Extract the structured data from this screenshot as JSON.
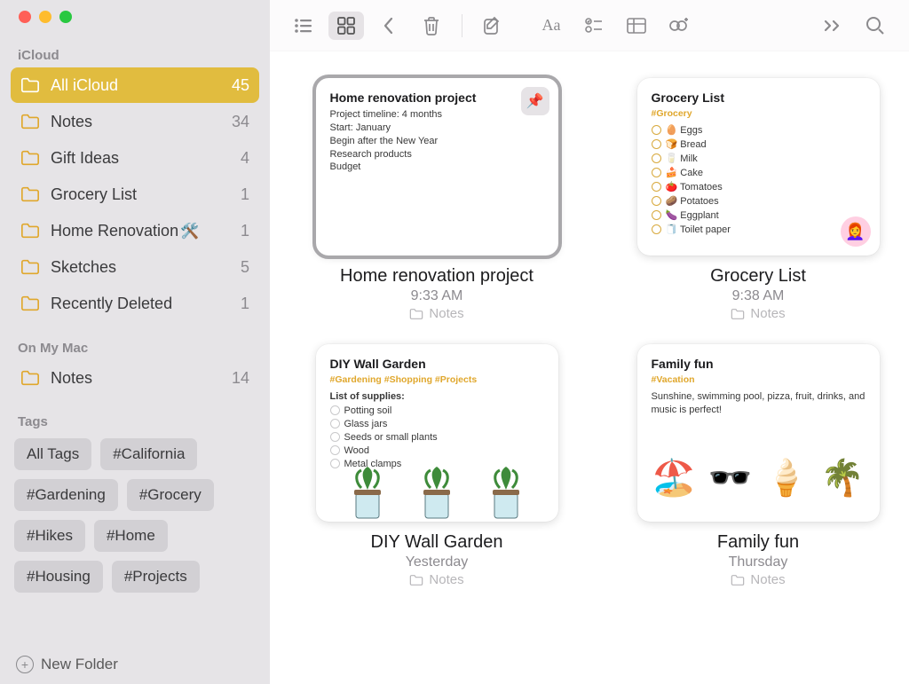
{
  "sidebar": {
    "sections": [
      {
        "header": "iCloud",
        "folders": [
          {
            "label": "All iCloud",
            "count": 45,
            "selected": true
          },
          {
            "label": "Notes",
            "count": 34
          },
          {
            "label": "Gift Ideas",
            "count": 4
          },
          {
            "label": "Grocery List",
            "count": 1
          },
          {
            "label": "Home Renovation",
            "emoji": "🛠️",
            "count": 1
          },
          {
            "label": "Sketches",
            "count": 5
          },
          {
            "label": "Recently Deleted",
            "count": 1
          }
        ]
      },
      {
        "header": "On My Mac",
        "folders": [
          {
            "label": "Notes",
            "count": 14
          }
        ]
      }
    ],
    "tags_header": "Tags",
    "tags": [
      "All Tags",
      "#California",
      "#Gardening",
      "#Grocery",
      "#Hikes",
      "#Home",
      "#Housing",
      "#Projects"
    ],
    "new_folder_label": "New Folder"
  },
  "notes": [
    {
      "id": "home-renovation",
      "selected": true,
      "pinned": true,
      "card_title": "Home renovation project",
      "body_lines": [
        "Project timeline: 4 months",
        "Start: January",
        "Begin after the New Year",
        "Research products",
        "Budget"
      ],
      "title": "Home renovation project",
      "time": "9:33 AM",
      "folder": "Notes"
    },
    {
      "id": "grocery-list",
      "card_title": "Grocery List",
      "hashtags": "#Grocery",
      "checklist": [
        {
          "emoji": "🥚",
          "label": "Eggs"
        },
        {
          "emoji": "🍞",
          "label": "Bread"
        },
        {
          "emoji": "🥛",
          "label": "Milk"
        },
        {
          "emoji": "🍰",
          "label": "Cake"
        },
        {
          "emoji": "🍅",
          "label": "Tomatoes"
        },
        {
          "emoji": "🥔",
          "label": "Potatoes"
        },
        {
          "emoji": "🍆",
          "label": "Eggplant"
        },
        {
          "emoji": "🧻",
          "label": "Toilet paper"
        }
      ],
      "avatar": "👩‍🦰",
      "title": "Grocery List",
      "time": "9:38 AM",
      "folder": "Notes"
    },
    {
      "id": "diy-wall-garden",
      "card_title": "DIY Wall Garden",
      "hashtags": "#Gardening #Shopping #Projects",
      "supplies_heading": "List of supplies:",
      "supplies": [
        "Potting soil",
        "Glass jars",
        "Seeds or small plants",
        "Wood",
        "Metal clamps"
      ],
      "has_garden_image": true,
      "title": "DIY Wall Garden",
      "time": "Yesterday",
      "folder": "Notes"
    },
    {
      "id": "family-fun",
      "card_title": "Family fun",
      "hashtags": "#Vacation",
      "body_text": "Sunshine, swimming pool, pizza, fruit, drinks, and music is perfect!",
      "family_icons": [
        "🏖️",
        "🕶️",
        "🍦",
        "🌴"
      ],
      "title": "Family fun",
      "time": "Thursday",
      "folder": "Notes"
    }
  ]
}
